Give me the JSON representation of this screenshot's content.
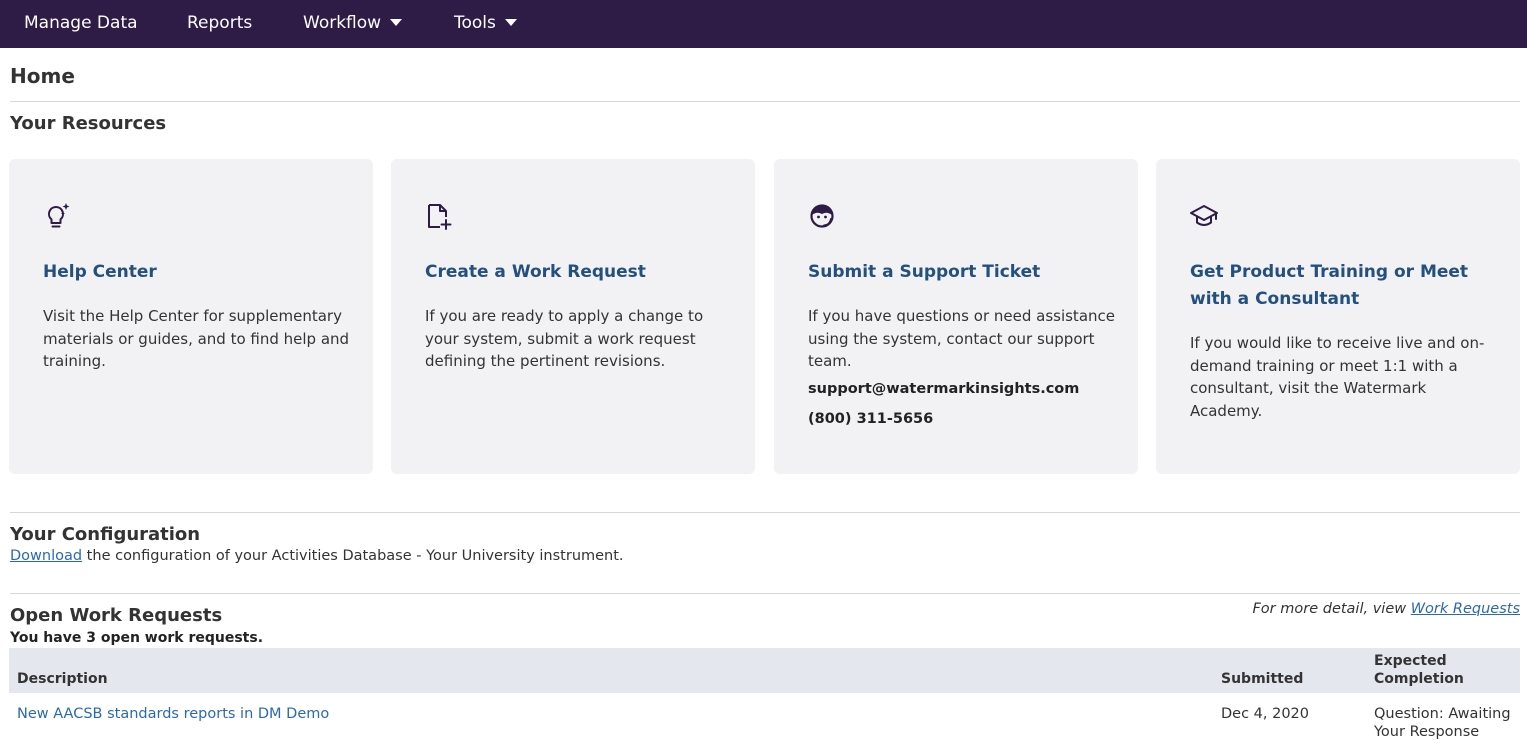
{
  "nav": {
    "manage_data": "Manage Data",
    "reports": "Reports",
    "workflow": "Workflow",
    "tools": "Tools"
  },
  "page": {
    "title": "Home"
  },
  "resources": {
    "title": "Your Resources",
    "cards": [
      {
        "icon": "lightbulb-icon",
        "title": "Help Center",
        "body": "Visit the Help Center for supplementary materials or guides, and to find help and training."
      },
      {
        "icon": "document-add-icon",
        "title": "Create a Work Request",
        "body": "If you are ready to apply a change to your system, submit a work request defining the pertinent revisions."
      },
      {
        "icon": "support-agent-icon",
        "title": "Submit a Support Ticket",
        "body": "If you have questions or need assistance using the system, contact our support team.",
        "email": "support@watermarkinsights.com",
        "phone": "(800) 311-5656"
      },
      {
        "icon": "graduation-cap-icon",
        "title": "Get Product Training or Meet with a Consultant",
        "body": "If you would like to receive live and on-demand training or meet 1:1 with a consultant, visit the Watermark Academy."
      }
    ]
  },
  "configuration": {
    "title": "Your Configuration",
    "download_link": "Download",
    "text": " the configuration of your Activities Database - Your University instrument."
  },
  "work_requests": {
    "title": "Open Work Requests",
    "detail_prefix": "For more detail, view ",
    "detail_link": "Work Requests",
    "count_text": "You have 3 open work requests.",
    "columns": {
      "description": "Description",
      "submitted": "Submitted",
      "expected": "Expected Completion"
    },
    "rows": [
      {
        "description": "New AACSB standards reports in DM Demo",
        "submitted": "Dec 4, 2020",
        "expected": "Question: Awaiting Your Response"
      }
    ]
  },
  "colors": {
    "navbar": "#2e1b46",
    "card_bg": "#f2f2f5",
    "card_title": "#23507f",
    "link": "#2a6ab0",
    "table_head": "#e4e7ee"
  }
}
